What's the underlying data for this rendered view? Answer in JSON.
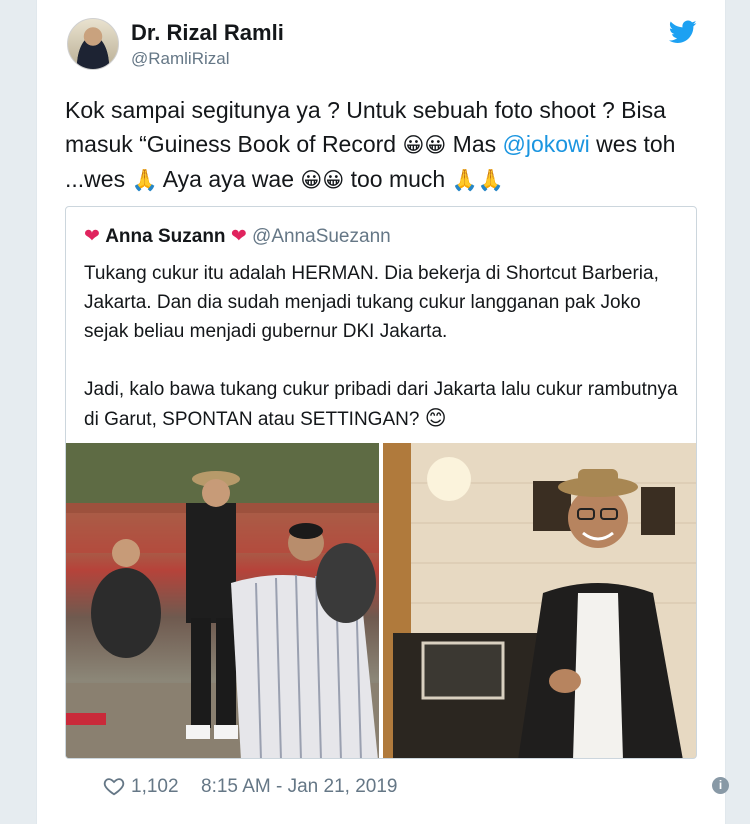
{
  "tweet": {
    "author_name": "Dr. Rizal Ramli",
    "author_handle": "@RamliRizal",
    "text_part1": "Kok sampai segitunya ya ? Untuk sebuah foto shoot ? Bisa masuk “Guiness Book of Record ",
    "emoji_grin": "😀😀",
    "text_part2": " Mas ",
    "mention": "@jokowi",
    "text_part3": " wes toh ...wes ",
    "emoji_pray": "🙏",
    "text_part4": " Aya aya wae ",
    "emoji_grin2": "😀😀",
    "text_part5": " too much ",
    "emoji_pray2": "🙏🙏",
    "likes": "1,102",
    "timestamp": "8:15 AM - Jan 21, 2019",
    "icons": {
      "brand": "twitter-bird-icon",
      "like": "heart-icon",
      "info": "info-icon"
    },
    "colors": {
      "brand": "#1da1f2",
      "mention": "#1b95e0",
      "heart_emoji": "#e0245e"
    }
  },
  "quoted": {
    "heart": "❤",
    "author_name": "Anna Suzann",
    "author_handle": "@AnnaSuezann",
    "paragraph1": "Tukang cukur itu adalah HERMAN. Dia bekerja di Shortcut Barberia, Jakarta. Dan dia sudah menjadi tukang cukur langganan pak Joko sejak beliau menjadi gubernur DKI Jakarta.",
    "paragraph2": "Jadi, kalo bawa tukang cukur pribadi dari Jakarta lalu cukur rambutnya di Garut, SPONTAN atau SETTINGAN? ",
    "emoji_smile": "😊"
  }
}
